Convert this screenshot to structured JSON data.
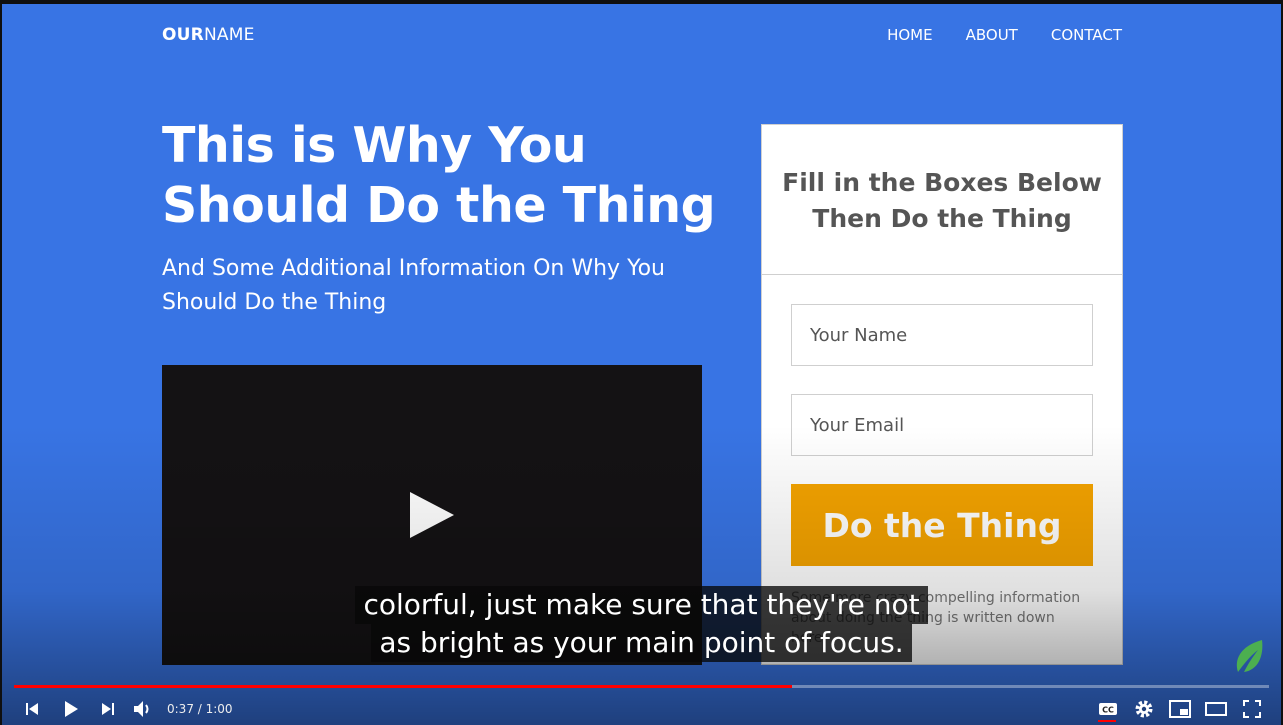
{
  "page": {
    "logo_bold": "OUR",
    "logo_rest": "NAME",
    "nav": [
      "HOME",
      "ABOUT",
      "CONTACT"
    ],
    "headline": "This is Why You Should Do the Thing",
    "subhead": "And Some Additional Information On Why You Should Do the Thing"
  },
  "form": {
    "title": "Fill in the Boxes Below Then Do the Thing",
    "name_placeholder": "Your Name",
    "email_placeholder": "Your Email",
    "cta_label": "Do the Thing",
    "note": "Some more crazy compelling information about doing the thing is written down here."
  },
  "captions": {
    "line1": "colorful, just make sure that they're not",
    "line2": "as bright as your main point of focus."
  },
  "player": {
    "time": "0:37 / 1:00",
    "progress": 0.62,
    "colors": {
      "background": "#3874e4",
      "cta": "#f4a300",
      "progress": "#ff0000",
      "leaf": "#4caf50"
    },
    "icons": [
      "previous-icon",
      "play-icon",
      "next-icon",
      "volume-icon",
      "captions-icon",
      "settings-icon",
      "miniplayer-icon",
      "theater-icon",
      "fullscreen-icon"
    ]
  }
}
